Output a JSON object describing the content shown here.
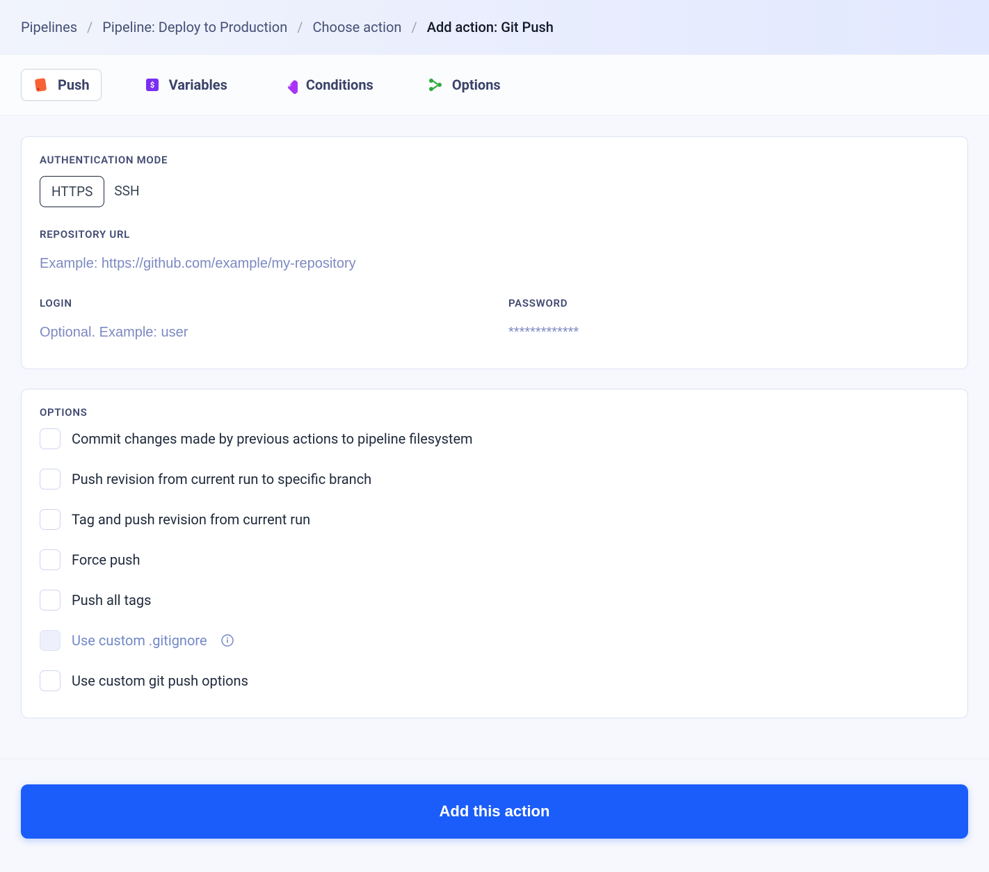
{
  "breadcrumb": {
    "items": [
      "Pipelines",
      "Pipeline: Deploy to Production",
      "Choose action",
      "Add action: Git Push"
    ]
  },
  "tabs": {
    "push": "Push",
    "variables": "Variables",
    "conditions": "Conditions",
    "options": "Options"
  },
  "auth": {
    "section_label": "AUTHENTICATION MODE",
    "https": "HTTPS",
    "ssh": "SSH"
  },
  "repo": {
    "label": "REPOSITORY URL",
    "placeholder": "Example: https://github.com/example/my-repository",
    "value": ""
  },
  "login": {
    "label": "LOGIN",
    "placeholder": "Optional. Example: user",
    "value": ""
  },
  "password": {
    "label": "PASSWORD",
    "placeholder": "*************",
    "value": ""
  },
  "options_section": {
    "label": "OPTIONS",
    "items": [
      {
        "label": "Commit changes made by previous actions to pipeline filesystem",
        "disabled": false,
        "info": false
      },
      {
        "label": "Push revision from current run to specific branch",
        "disabled": false,
        "info": false
      },
      {
        "label": "Tag and push revision from current run",
        "disabled": false,
        "info": false
      },
      {
        "label": "Force push",
        "disabled": false,
        "info": false
      },
      {
        "label": "Push all tags",
        "disabled": false,
        "info": false
      },
      {
        "label": "Use custom .gitignore",
        "disabled": true,
        "info": true
      },
      {
        "label": "Use custom git push options",
        "disabled": false,
        "info": false
      }
    ]
  },
  "footer": {
    "add_button": "Add this action"
  }
}
